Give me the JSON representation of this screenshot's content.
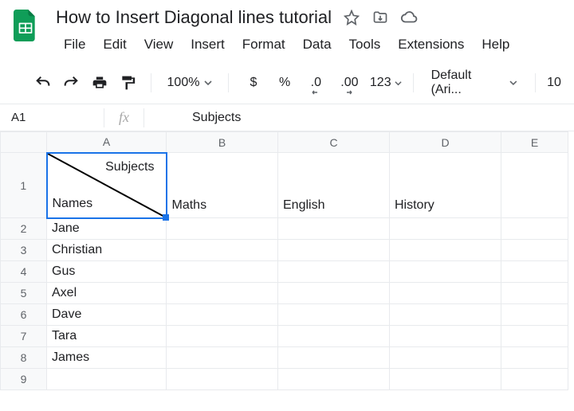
{
  "doc": {
    "title": "How to Insert Diagonal lines tutorial"
  },
  "menu": {
    "file": "File",
    "edit": "Edit",
    "view": "View",
    "insert": "Insert",
    "format": "Format",
    "data": "Data",
    "tools": "Tools",
    "extensions": "Extensions",
    "help": "Help"
  },
  "toolbar": {
    "zoom": "100%",
    "currency": "$",
    "percent": "%",
    "dec_minus": ".0",
    "dec_plus": ".00",
    "more_fmt": "123",
    "font": "Default (Ari...",
    "font_size": "10"
  },
  "fx": {
    "name_box": "A1",
    "label": "fx",
    "content": "Subjects"
  },
  "columns": [
    "A",
    "B",
    "C",
    "D",
    "E"
  ],
  "a1": {
    "top": "Subjects",
    "bottom": "Names"
  },
  "header_row": {
    "B": "Maths",
    "C": "English",
    "D": "History"
  },
  "rows": [
    {
      "n": "1"
    },
    {
      "n": "2",
      "A": "Jane"
    },
    {
      "n": "3",
      "A": "Christian"
    },
    {
      "n": "4",
      "A": "Gus"
    },
    {
      "n": "5",
      "A": "Axel"
    },
    {
      "n": "6",
      "A": "Dave"
    },
    {
      "n": "7",
      "A": "Tara"
    },
    {
      "n": "8",
      "A": "James"
    },
    {
      "n": "9"
    }
  ]
}
